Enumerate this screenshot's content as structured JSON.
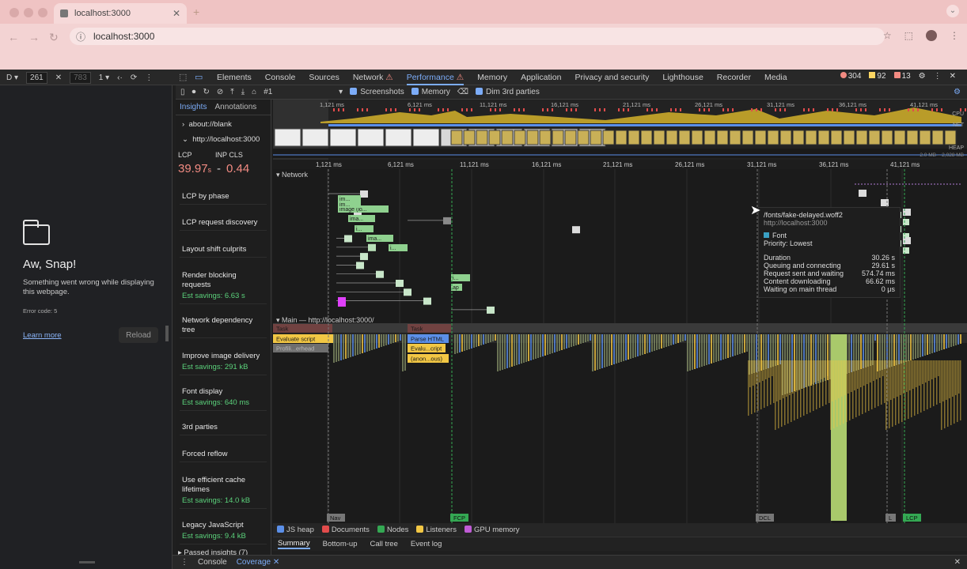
{
  "browser": {
    "tab_title": "localhost:3000",
    "url": "localhost:3000"
  },
  "device": {
    "width": "261",
    "height": "783",
    "zoom": "1"
  },
  "devtools": {
    "tabs": [
      "Elements",
      "Console",
      "Sources",
      "Network",
      "Performance",
      "Memory",
      "Application",
      "Privacy and security",
      "Lighthouse",
      "Recorder",
      "Media"
    ],
    "active_tab": "Performance",
    "errors": "304",
    "warnings": "92",
    "issues": "13"
  },
  "page": {
    "heading": "Aw, Snap!",
    "message": "Something went wrong while displaying this webpage.",
    "error_code": "Error code: 5",
    "learn_more": "Learn more",
    "reload": "Reload"
  },
  "perf_toolbar": {
    "recording": "#1",
    "screenshots": "Screenshots",
    "memory": "Memory",
    "dim3p": "Dim 3rd parties"
  },
  "insights": {
    "tabs": [
      "Insights",
      "Annotations"
    ],
    "navs": [
      "about://blank",
      "http://localhost:3000"
    ],
    "lcp_label": "LCP",
    "inp_cls_label": "INP CLS",
    "lcp_value": "39.97",
    "lcp_unit": "s",
    "inp_dash": "-",
    "cls_value": "0.44",
    "items": [
      {
        "label": "LCP by phase",
        "savings": ""
      },
      {
        "label": "LCP request discovery",
        "savings": ""
      },
      {
        "label": "Layout shift culprits",
        "savings": ""
      },
      {
        "label": "Render blocking requests",
        "savings": "Est savings: 6.63 s"
      },
      {
        "label": "Network dependency tree",
        "savings": ""
      },
      {
        "label": "Improve image delivery",
        "savings": "Est savings: 291 kB"
      },
      {
        "label": "Font display",
        "savings": "Est savings: 640 ms"
      },
      {
        "label": "3rd parties",
        "savings": ""
      },
      {
        "label": "Forced reflow",
        "savings": ""
      },
      {
        "label": "Use efficient cache lifetimes",
        "savings": "Est savings: 14.0 kB"
      },
      {
        "label": "Legacy JavaScript",
        "savings": "Est savings: 9.4 kB"
      }
    ],
    "passed": "Passed insights (7)"
  },
  "timeline": {
    "overview_ticks": [
      "1,121 ms",
      "6,121 ms",
      "11,121 ms",
      "16,121 ms",
      "21,121 ms",
      "26,121 ms",
      "31,121 ms",
      "36,121 ms",
      "41,121 ms"
    ],
    "ruler_ticks": [
      "1,121 ms",
      "6,121 ms",
      "11,121 ms",
      "16,121 ms",
      "21,121 ms",
      "26,121 ms",
      "31,121 ms",
      "36,121 ms",
      "41,121 ms"
    ],
    "cpu": "CPU",
    "net": "NET",
    "heap": "HEAP",
    "heap_range": "2.0 MB – 2,028 MB",
    "network_label": "Network",
    "main_label": "Main — http://localhost:3000/",
    "markers": [
      "Nav",
      "FCP",
      "DCL",
      "L",
      "LCP"
    ],
    "main_entries": [
      "Task",
      "Evaluate script",
      "Profili...erhead",
      "Task",
      "Parse HTML",
      "Evalu...cript",
      "(anon...ous)"
    ],
    "net_entries": [
      "im...",
      "image (lo...",
      "ima...",
      "i...",
      "ima...",
      "i...",
      "im...",
      "i...",
      "ap",
      "a..."
    ]
  },
  "tooltip": {
    "url": "/fonts/fake-delayed.woff2",
    "host": "http://localhost:3000",
    "type": "Font",
    "priority": "Priority: Lowest",
    "rows": [
      {
        "label": "Duration",
        "value": "30.26 s"
      },
      {
        "label": "Queuing and connecting",
        "value": "29.61 s"
      },
      {
        "label": "Request sent and waiting",
        "value": "574.74 ms"
      },
      {
        "label": "Content downloading",
        "value": "66.62 ms"
      },
      {
        "label": "Waiting on main thread",
        "value": "0 μs"
      }
    ]
  },
  "tracks": [
    "JS heap",
    "Documents",
    "Nodes",
    "Listeners",
    "GPU memory"
  ],
  "bottom_tabs": [
    "Summary",
    "Bottom-up",
    "Call tree",
    "Event log"
  ],
  "drawer": [
    "Console",
    "Coverage"
  ],
  "colors": {
    "accent": "#7cacf8",
    "error": "#f28b82",
    "savings": "#5bd27b",
    "script": "#f2c744",
    "html": "#5b8fe8",
    "chrome": "#efc3c3"
  }
}
